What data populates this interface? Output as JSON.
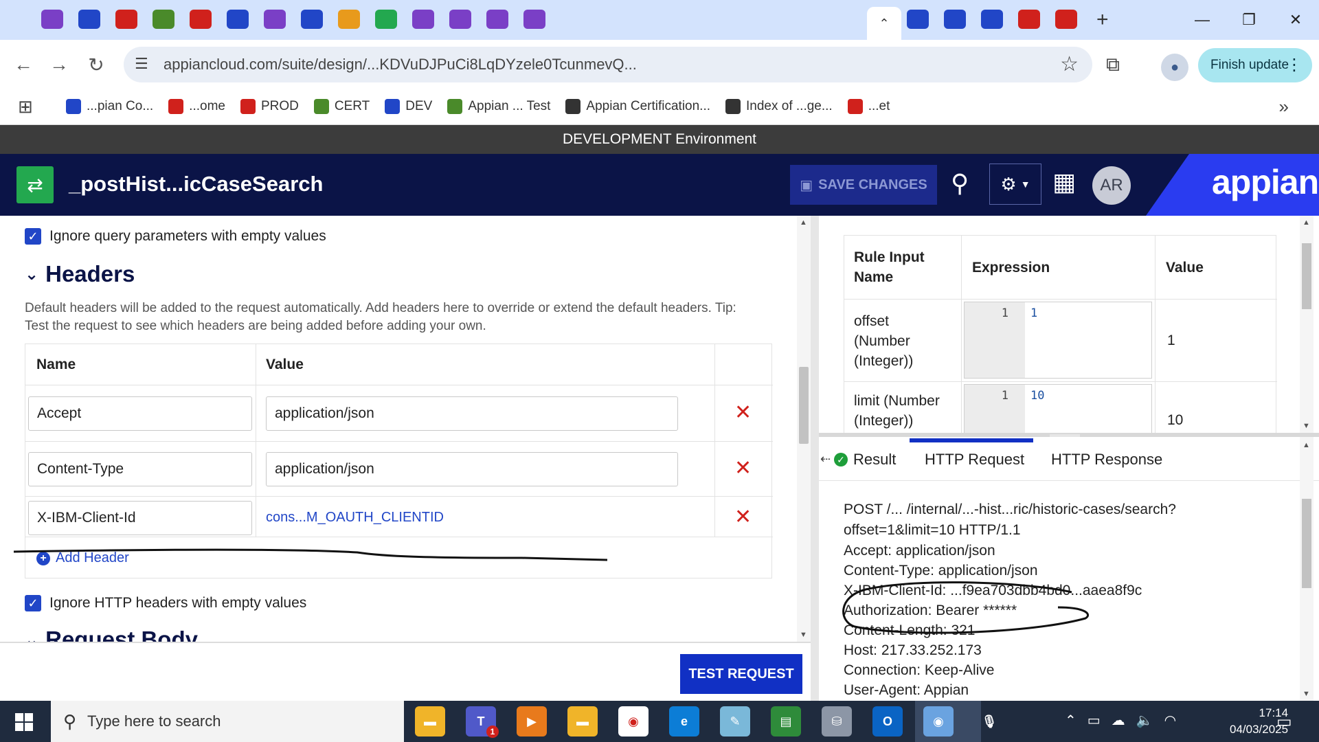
{
  "browser": {
    "tab_strip": {
      "active_tab_glyph": "⌃",
      "new_tab": "+",
      "window_controls": [
        "—",
        "❐",
        "✕"
      ]
    },
    "toolbar": {
      "back": "←",
      "forward": "→",
      "reload": "↻",
      "url": "appiancloud.com/suite/design/...KDVuDJPuCi8LqDYzele0TcunmevQ...",
      "star": "☆",
      "extensions": "⧉",
      "finish_update": "Finish update",
      "menu": "⋮"
    },
    "bookmarks": [
      {
        "label": "...pian Co...",
        "color": "#2146c7"
      },
      {
        "label": "...ome",
        "color": "#d0211c"
      },
      {
        "label": "PROD",
        "color": "#d0211c"
      },
      {
        "label": "CERT",
        "color": "#4a8a2a"
      },
      {
        "label": "DEV",
        "color": "#2146c7"
      },
      {
        "label": "Appian ... Test",
        "color": "#4a8a2a"
      },
      {
        "label": "Appian Certification...",
        "color": "#333333"
      },
      {
        "label": "Index of ...ge...",
        "color": "#333333"
      },
      {
        "label": "...et",
        "color": "#d0211c"
      }
    ],
    "bookmarks_more": "»"
  },
  "env_banner": "DEVELOPMENT Environment",
  "header": {
    "object_title": "_postHist...icCaseSearch",
    "save_changes": "SAVE CHANGES",
    "avatar": "AR",
    "brand": "appian"
  },
  "left": {
    "ignore_query": "Ignore query parameters with empty values",
    "headers_title": "Headers",
    "headers_desc": "Default headers will be added to the request automatically. Add headers here to override or extend the default headers. Tip: Test the request to see which headers are being added before adding your own.",
    "col_name": "Name",
    "col_value": "Value",
    "rows": [
      {
        "name": "Accept",
        "value": "application/json"
      },
      {
        "name": "Content-Type",
        "value": "application/json"
      },
      {
        "name": "X-IBM-Client-Id",
        "value": "cons...M_OAUTH_CLIENTID"
      }
    ],
    "add_header": "Add Header",
    "ignore_http": "Ignore HTTP headers with empty values",
    "request_body": "Request Body",
    "test_request": "TEST REQUEST"
  },
  "rule_inputs": {
    "col_name_line1": "Rule Input",
    "col_name_line2": "Name",
    "col_expression": "Expression",
    "col_value": "Value",
    "rows": [
      {
        "name_l1": "offset",
        "name_l2": "(Number",
        "name_l3": "(Integer))",
        "line": "1",
        "expr": "1",
        "value": "1"
      },
      {
        "name_l1": "limit (Number",
        "name_l2": "(Integer))",
        "line": "1",
        "expr": "10",
        "value": "10"
      }
    ]
  },
  "result_tabs": {
    "result": "Result",
    "http_request": "HTTP Request",
    "http_response": "HTTP Response"
  },
  "http_request_lines": [
    "POST /... /internal/...-hist...ric/historic-cases/search?",
    "offset=1&limit=10 HTTP/1.1",
    "Accept: application/json",
    "Content-Type: application/json",
    "X-IBM-Client-Id: ...f9ea703dbb4bd0...aaea8f9c",
    "Authorization: Bearer ******",
    "Content-Length: 321",
    "Host: 217.33.252.173",
    "Connection: Keep-Alive",
    "User-Agent: Appian"
  ],
  "taskbar": {
    "search_placeholder": "Type here to search",
    "time": "17:14",
    "date": "04/03/2025",
    "teams_badge": "1"
  }
}
